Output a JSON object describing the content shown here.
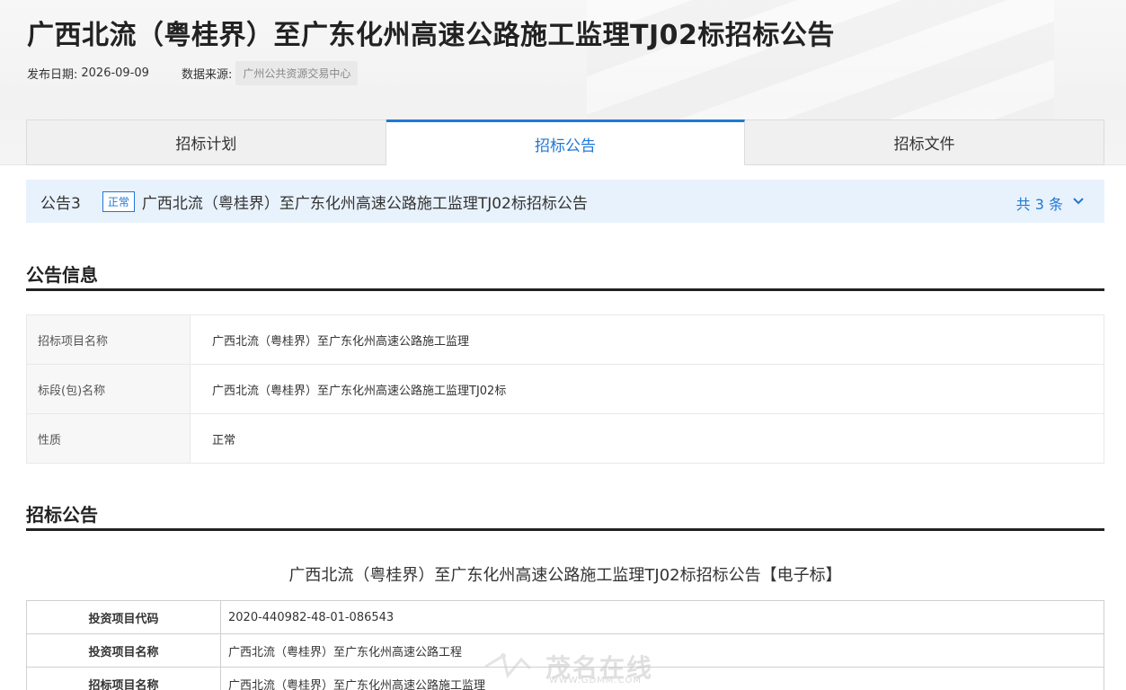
{
  "page": {
    "title": "广西北流（粤桂界）至广东化州高速公路施工监理TJ02标招标公告",
    "publish_label": "发布日期:",
    "publish_date": "2026-09-09",
    "source_label": "数据来源:",
    "source": "广州公共资源交易中心"
  },
  "tabs": [
    {
      "label": "招标计划",
      "active": false
    },
    {
      "label": "招标公告",
      "active": true
    },
    {
      "label": "招标文件",
      "active": false
    }
  ],
  "notice_bar": {
    "notice_no": "公告3",
    "status": "正常",
    "title": "广西北流（粤桂界）至广东化州高速公路施工监理TJ02标招标公告",
    "count": "共 3 条",
    "icon": "chevron-down-icon"
  },
  "section_info": {
    "heading": "公告信息",
    "rows": [
      {
        "key": "招标项目名称",
        "value": "广西北流（粤桂界）至广东化州高速公路施工监理"
      },
      {
        "key": "标段(包)名称",
        "value": "广西北流（粤桂界）至广东化州高速公路施工监理TJ02标"
      },
      {
        "key": "性质",
        "value": "正常"
      }
    ]
  },
  "section_notice": {
    "heading": "招标公告",
    "doc_title": "广西北流（粤桂界）至广东化州高速公路施工监理TJ02标招标公告【电子标】",
    "rows": [
      {
        "key": "投资项目代码",
        "value": "2020-440982-48-01-086543"
      },
      {
        "key": "投资项目名称",
        "value": "广西北流（粤桂界）至广东化州高速公路工程"
      },
      {
        "key": "招标项目名称",
        "value": "广西北流（粤桂界）至广东化州高速公路施工监理"
      }
    ]
  },
  "watermark": {
    "text": "茂名在线",
    "sub": "WWW.GDMM.COM"
  },
  "colors": {
    "accent": "#1e78d6",
    "notice_bg": "#e8f2fc"
  }
}
